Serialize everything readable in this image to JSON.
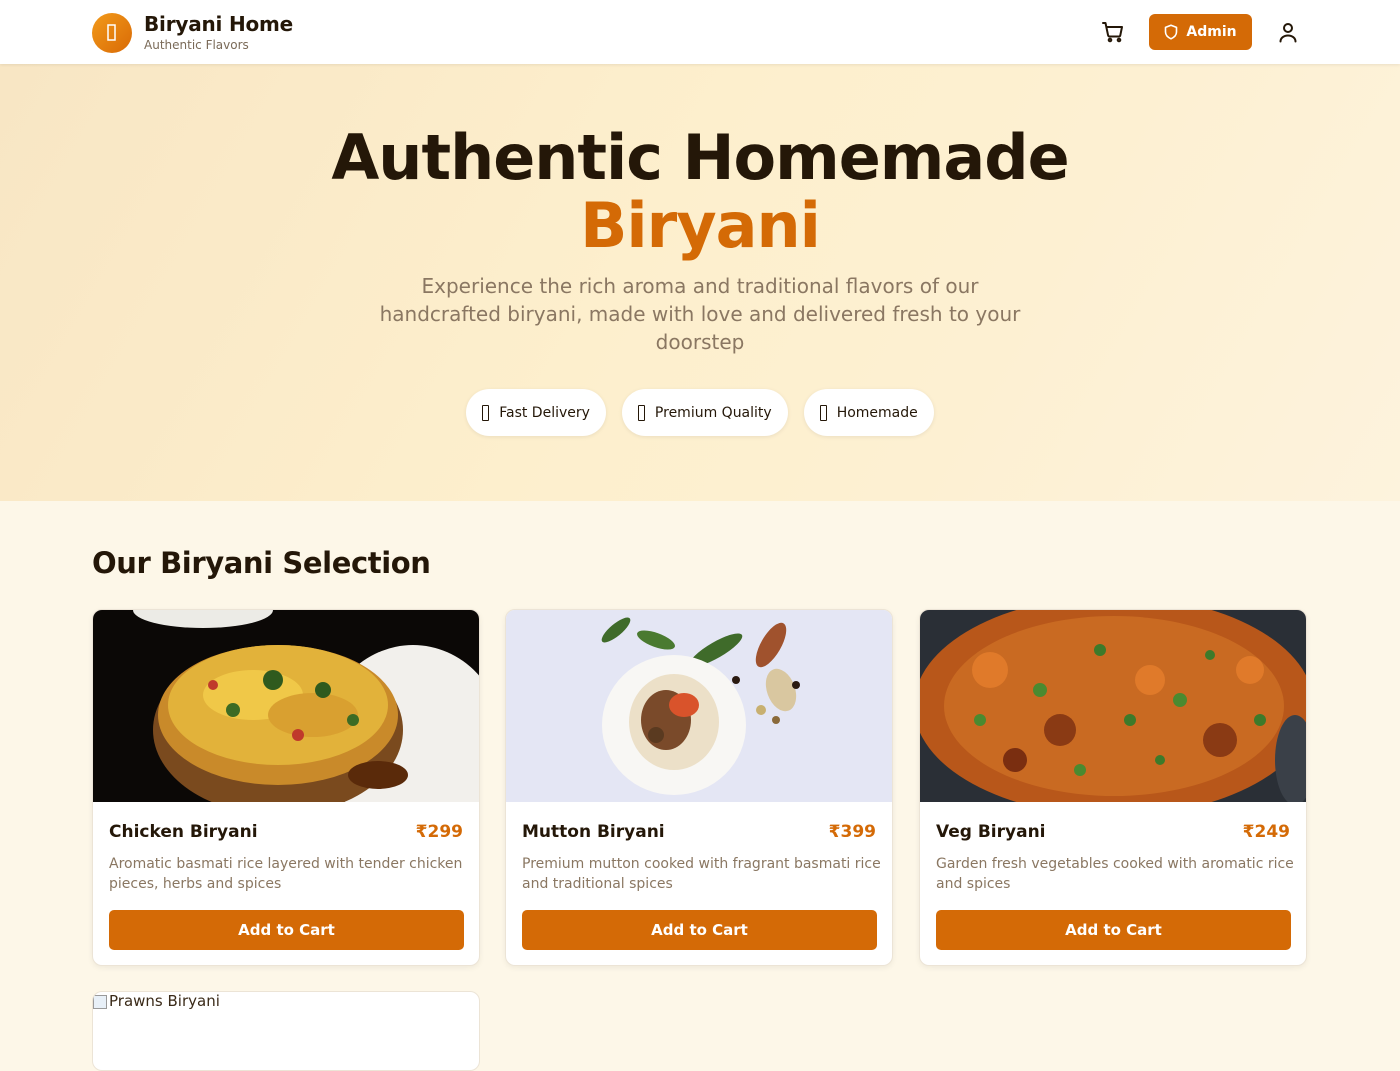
{
  "header": {
    "brand_title": "Biryani Home",
    "brand_subtitle": "Authentic Flavors",
    "logo_icon": "leaf-icon",
    "cart_icon": "cart-icon",
    "admin_label": "Admin",
    "admin_icon": "shield-icon",
    "user_icon": "user-icon"
  },
  "hero": {
    "title": "Authentic Homemade",
    "title_accent": "Biryani",
    "description": "Experience the rich aroma and traditional flavors of our handcrafted biryani, made with love and delivered fresh to your doorstep",
    "features": [
      {
        "label": "Fast Delivery"
      },
      {
        "label": "Premium Quality"
      },
      {
        "label": "Homemade"
      }
    ]
  },
  "menu": {
    "section_title": "Our Biryani Selection",
    "items": [
      {
        "name": "Chicken Biryani",
        "price": "₹299",
        "description": "Aromatic basmati rice layered with tender chicken pieces, herbs and spices",
        "button": "Add to Cart"
      },
      {
        "name": "Mutton Biryani",
        "price": "₹399",
        "description": "Premium mutton cooked with fragrant basmati rice and traditional spices",
        "button": "Add to Cart"
      },
      {
        "name": "Veg Biryani",
        "price": "₹249",
        "description": "Garden fresh vegetables cooked with aromatic rice and spices",
        "button": "Add to Cart"
      },
      {
        "name": "Prawns Biryani",
        "image_alt": "Prawns Biryani"
      }
    ]
  },
  "colors": {
    "accent": "#d46a06",
    "background": "#fdf7e8",
    "text": "#241708",
    "muted": "#8a7762"
  }
}
